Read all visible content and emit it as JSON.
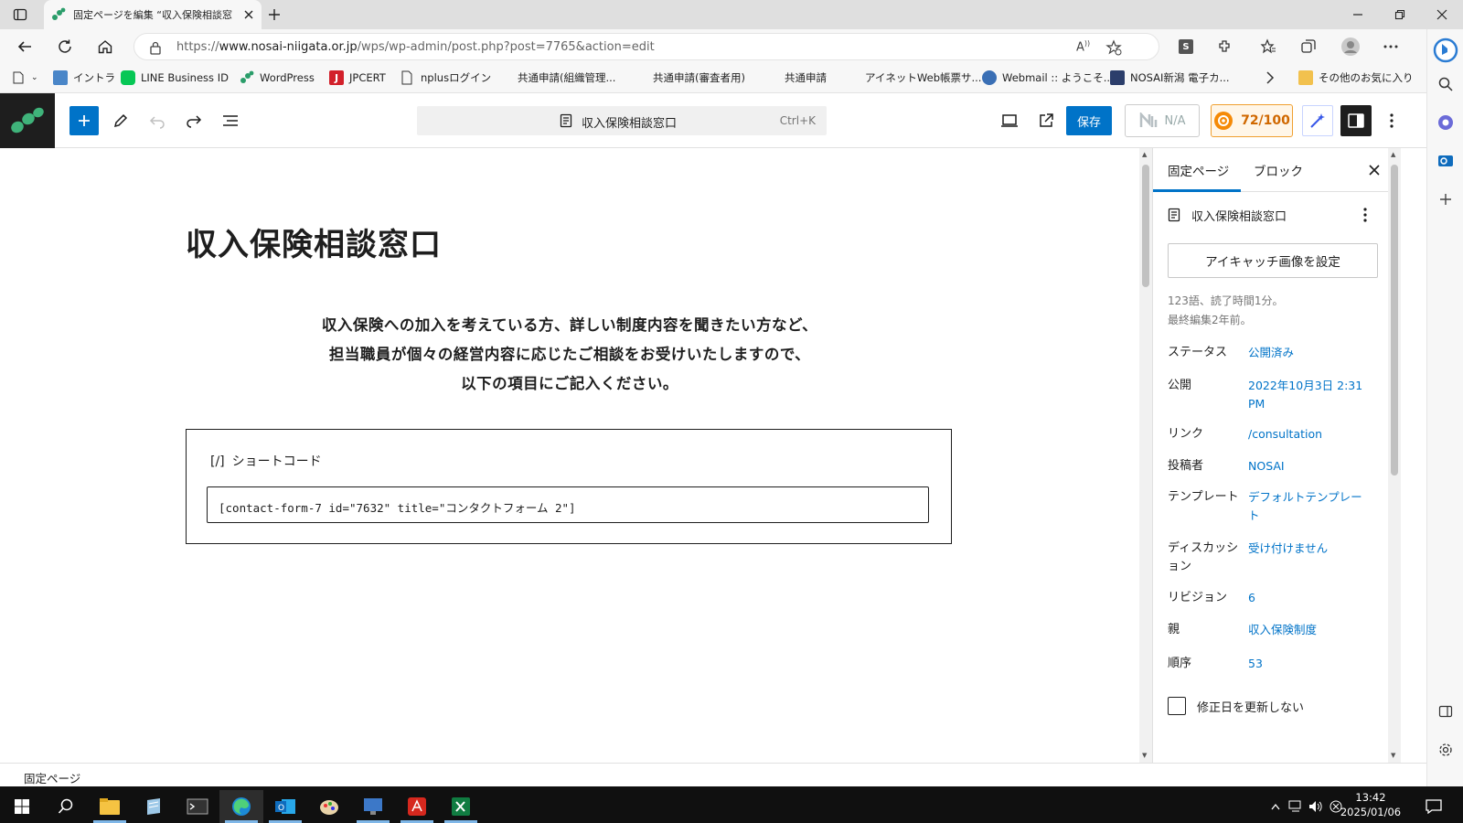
{
  "browser": {
    "tab_title": "固定ページを編集 “収入保険相談窓",
    "url_prefix": "https://",
    "url_host": "www.nosai-niigata.or.jp",
    "url_path": "/wps/wp-admin/post.php?post=7765&action=edit",
    "read_aloud_label": "A",
    "profile_letter": "S"
  },
  "bookmarks": [
    {
      "label": "イントラ",
      "icon": "intranet-icon"
    },
    {
      "label": "LINE Business ID",
      "icon": "line-icon"
    },
    {
      "label": "WordPress",
      "icon": "wordpress-icon"
    },
    {
      "label": "JPCERT",
      "icon": "jpcert-icon"
    },
    {
      "label": "nplusログイン",
      "icon": "page-icon"
    },
    {
      "label": "共通申請(組織管理...",
      "icon": ""
    },
    {
      "label": "共通申請(審査者用)",
      "icon": ""
    },
    {
      "label": "共通申請",
      "icon": ""
    },
    {
      "label": "アイネットWeb帳票サ...",
      "icon": ""
    },
    {
      "label": "Webmail :: ようこそ...",
      "icon": "webmail-icon"
    },
    {
      "label": "NOSAI新潟 電子カ...",
      "icon": "nosai-icon"
    },
    {
      "label": "その他のお気に入り",
      "icon": "folder-icon"
    }
  ],
  "toolbar": {
    "command_title": "収入保険相談窓口",
    "command_shortcut": "Ctrl+K",
    "save_label": "保存",
    "na_label": "N/A",
    "score_label": "72/100"
  },
  "editor": {
    "title": "収入保険相談窓口",
    "paragraph_lines": [
      "収入保険への加入を考えている方、詳しい制度内容を聞きたい方など、",
      "担当職員が個々の経営内容に応じたご相談をお受けいたしますので、",
      "以下の項目にご記入ください。"
    ],
    "shortcode_icon_text": "[/]",
    "shortcode_label": "ショートコード",
    "shortcode_value": "[contact-form-7 id=\"7632\" title=\"コンタクトフォーム 2\"]"
  },
  "sidebar": {
    "tab_page": "固定ページ",
    "tab_block": "ブロック",
    "page_name": "収入保険相談窓口",
    "featured_image_button": "アイキャッチ画像を設定",
    "word_count": "123語、読了時間1分。",
    "last_edited": "最終編集2年前。",
    "properties": [
      {
        "label": "ステータス",
        "value": "公開済み"
      },
      {
        "label": "公開",
        "value": "2022年10月3日 2:31 PM"
      },
      {
        "label": "リンク",
        "value": "/consultation"
      },
      {
        "label": "投稿者",
        "value": "NOSAI"
      },
      {
        "label": "テンプレート",
        "value": "デフォルトテンプレート"
      },
      {
        "label": "ディスカッション",
        "value": "受け付けません"
      },
      {
        "label": "リビジョン",
        "value": "6"
      },
      {
        "label": "親",
        "value": "収入保険制度"
      },
      {
        "label": "順序",
        "value": "53"
      }
    ],
    "checkbox_label": "修正日を更新しない"
  },
  "footer": {
    "breadcrumb": "固定ページ"
  },
  "taskbar": {
    "time": "13:42",
    "date": "2025/01/06"
  },
  "colors": {
    "wp_blue": "#0073c8",
    "dark": "#1e1e1e",
    "score_orange": "#d06800"
  }
}
